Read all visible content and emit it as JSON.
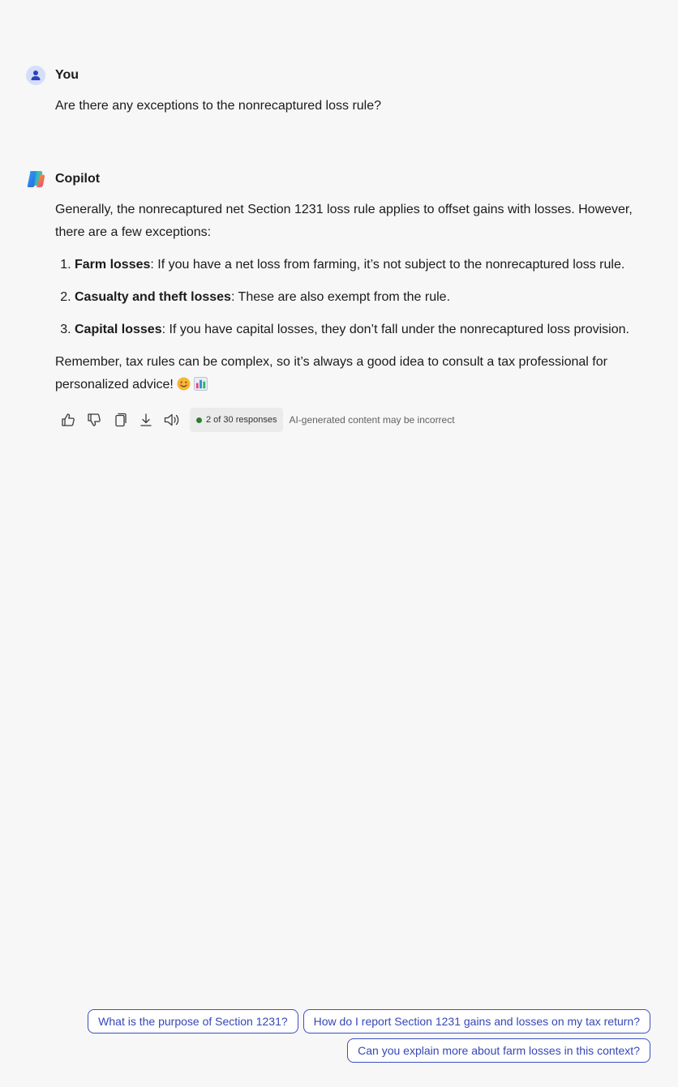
{
  "conversation": {
    "user": {
      "author": "You",
      "message": "Are there any exceptions to the nonrecaptured loss rule?"
    },
    "assistant": {
      "author": "Copilot",
      "intro": "Generally, the nonrecaptured net Section 1231 loss rule applies to offset gains with losses. However, there are a few exceptions:",
      "items": [
        {
          "term": "Farm losses",
          "text": ": If you have a net loss from farming, it’s not subject to the nonrecaptured loss rule."
        },
        {
          "term": "Casualty and theft losses",
          "text": ": These are also exempt from the rule."
        },
        {
          "term": "Capital losses",
          "text": ": If you have capital losses, they don’t fall under the nonrecaptured loss provision."
        }
      ],
      "closing": "Remember, tax rules can be complex, so it’s always a good idea to consult a tax professional for personalized advice!",
      "closing_emojis": [
        "smiling-face-emoji",
        "bar-chart-emoji"
      ]
    }
  },
  "actions": {
    "icons": [
      "thumbs-up-icon",
      "thumbs-down-icon",
      "copy-icon",
      "download-icon",
      "read-aloud-icon"
    ],
    "response_count": "2 of 30 responses",
    "disclaimer": "AI-generated content may be incorrect"
  },
  "suggestions": [
    "What is the purpose of Section 1231?",
    "How do I report Section 1231 gains and losses on my tax return?",
    "Can you explain more about farm losses in this context?"
  ],
  "colors": {
    "background": "#f7f7f7",
    "chip_border": "#3b4fc4",
    "chip_text": "#3547b8",
    "status_dot": "#2e7d32"
  }
}
